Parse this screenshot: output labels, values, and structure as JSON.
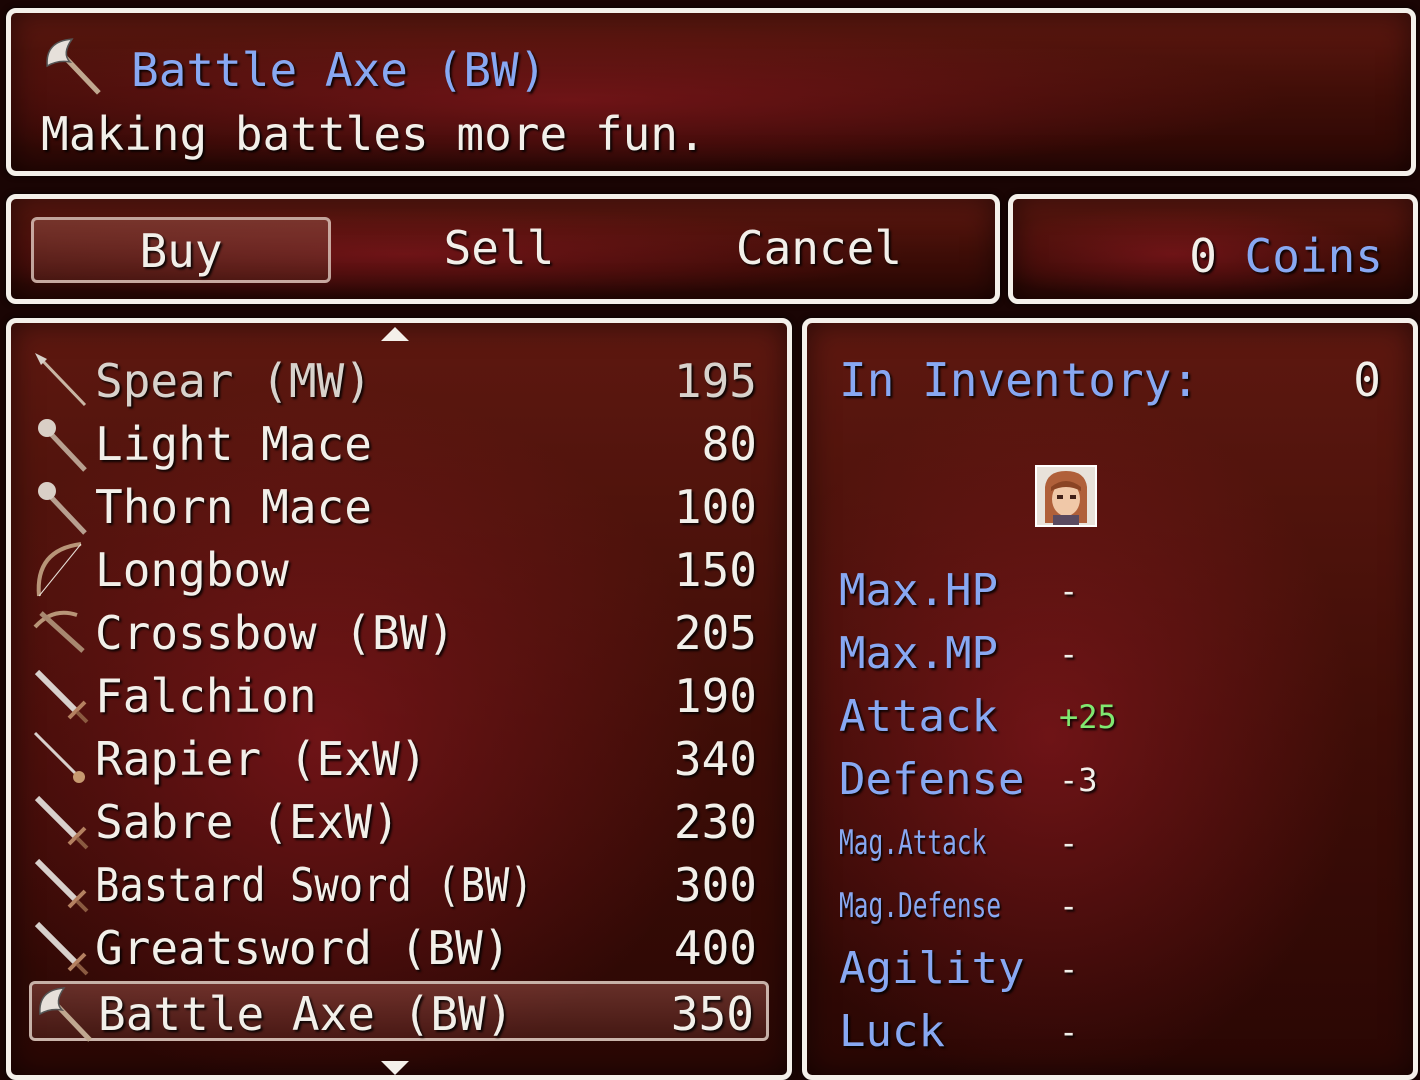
{
  "help": {
    "item_icon": "battle-axe-icon",
    "item_name": "Battle Axe (BW)",
    "description": "Making battles more fun."
  },
  "commands": {
    "buy": "Buy",
    "sell": "Sell",
    "cancel": "Cancel",
    "selected": "Buy"
  },
  "gold": {
    "amount": "0",
    "unit": "Coins"
  },
  "shop_list": {
    "items": [
      {
        "icon": "spear-icon",
        "name": "Spear (MW)",
        "price": "195"
      },
      {
        "icon": "mace-icon",
        "name": "Light Mace",
        "price": "80"
      },
      {
        "icon": "mace-icon",
        "name": "Thorn Mace",
        "price": "100"
      },
      {
        "icon": "bow-icon",
        "name": "Longbow",
        "price": "150"
      },
      {
        "icon": "crossbow-icon",
        "name": "Crossbow (BW)",
        "price": "205"
      },
      {
        "icon": "sword-icon",
        "name": "Falchion",
        "price": "190"
      },
      {
        "icon": "rapier-icon",
        "name": "Rapier (ExW)",
        "price": "340"
      },
      {
        "icon": "sword-icon",
        "name": "Sabre (ExW)",
        "price": "230"
      },
      {
        "icon": "sword-icon",
        "name": "Bastard Sword (BW)",
        "price": "300"
      },
      {
        "icon": "sword-icon",
        "name": "Greatsword (BW)",
        "price": "400"
      },
      {
        "icon": "battle-axe-icon",
        "name": "Battle Axe (BW)",
        "price": "350"
      }
    ],
    "selected_index": 10
  },
  "status": {
    "inventory_label": "In Inventory:",
    "inventory_count": "0",
    "actor_face": "actor-face-icon",
    "stats": [
      {
        "name": "Max.HP",
        "value": "-"
      },
      {
        "name": "Max.MP",
        "value": "-"
      },
      {
        "name": "Attack",
        "value": "+25"
      },
      {
        "name": "Defense",
        "value": "-3"
      },
      {
        "name": "Mag.Attack",
        "value": "-"
      },
      {
        "name": "Mag.Defense",
        "value": "-"
      },
      {
        "name": "Agility",
        "value": "-"
      },
      {
        "name": "Luck",
        "value": "-"
      }
    ]
  },
  "colors": {
    "system_text": "#88a8f2",
    "normal_text": "#f2efe9",
    "power_up": "#80e870",
    "window_border": "#f4f0ea"
  }
}
